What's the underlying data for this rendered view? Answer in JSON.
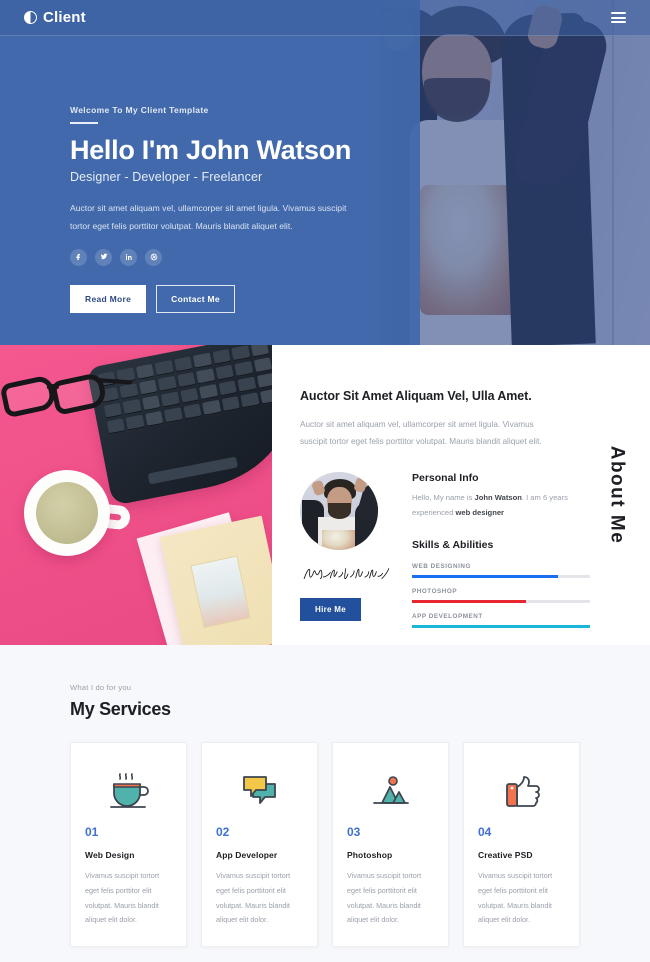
{
  "nav": {
    "brand": "Client",
    "brand_icon": "half-circle-icon",
    "menu_icon": "hamburger-menu-icon"
  },
  "hero": {
    "welcome": "Welcome To My Client Template",
    "title": "Hello I'm John Watson",
    "subtitle": "Designer - Developer - Freelancer",
    "description": "Auctor sit amet aliquam vel, ullamcorper sit amet ligula. Vivamus suscipit tortor eget felis porttitor volutpat. Mauris blandit aliquet elit.",
    "socials": [
      {
        "name": "facebook-icon",
        "glyph": "f"
      },
      {
        "name": "twitter-icon",
        "glyph": "t"
      },
      {
        "name": "linkedin-icon",
        "glyph": "in"
      },
      {
        "name": "dribbble-icon",
        "glyph": "o"
      }
    ],
    "primary_button": "Read More",
    "secondary_button": "Contact Me",
    "background_color": "#4169ab"
  },
  "about": {
    "vertical_label": "About Me",
    "heading": "Auctor Sit Amet Aliquam Vel, Ulla Amet.",
    "description": "Auctor sit amet aliquam vel, ullamcorper sit amet ligula. Vivamus suscipit tortor eget felis porttitor volutpat. Mauris blandit aliquet elit.",
    "signature_name": "Alejandro Lobotko",
    "hire_button": "Hire Me",
    "personal_info": {
      "title": "Personal Info",
      "line_1": "Hello, My name is ",
      "name": "John Watson",
      "line_2": ". I am 6 years experienced ",
      "role": "web designer"
    },
    "skills": {
      "title": "Skills & Abilities",
      "items": [
        {
          "label": "WEB DESIGNING",
          "value": 82,
          "color": "#1a6ef0"
        },
        {
          "label": "PHOTOSHOP",
          "value": 64,
          "color": "#e8262f"
        },
        {
          "label": "APP DEVELOPMENT",
          "value": 100,
          "color": "#19b6d8"
        }
      ]
    }
  },
  "services": {
    "eyebrow": "What I do for you",
    "title": "My Services",
    "cards": [
      {
        "icon": "coffee-cup-icon",
        "number": "01",
        "name": "Web Design",
        "description": "Vivamus suscipit tortort eget felis porttitor elit volutpat. Mauris blandit aliquet elit dolor."
      },
      {
        "icon": "chat-bubbles-icon",
        "number": "02",
        "name": "App Developer",
        "description": "Vivamus suscipit tortort eget felis porttitorit elit volutpat. Mauris blandit aliquet elit dolor."
      },
      {
        "icon": "mountain-photo-icon",
        "number": "03",
        "name": "Photoshop",
        "description": "Vivamus suscipit tortort eget felis porttitorit elit volutpat. Mauris blandit aliquet elit dolor."
      },
      {
        "icon": "thumbs-up-icon",
        "number": "04",
        "name": "Creative PSD",
        "description": "Vivamus suscipit tortort eget felis porttitorit elit volutpat. Mauris blandit aliquet elit dolor."
      }
    ]
  }
}
